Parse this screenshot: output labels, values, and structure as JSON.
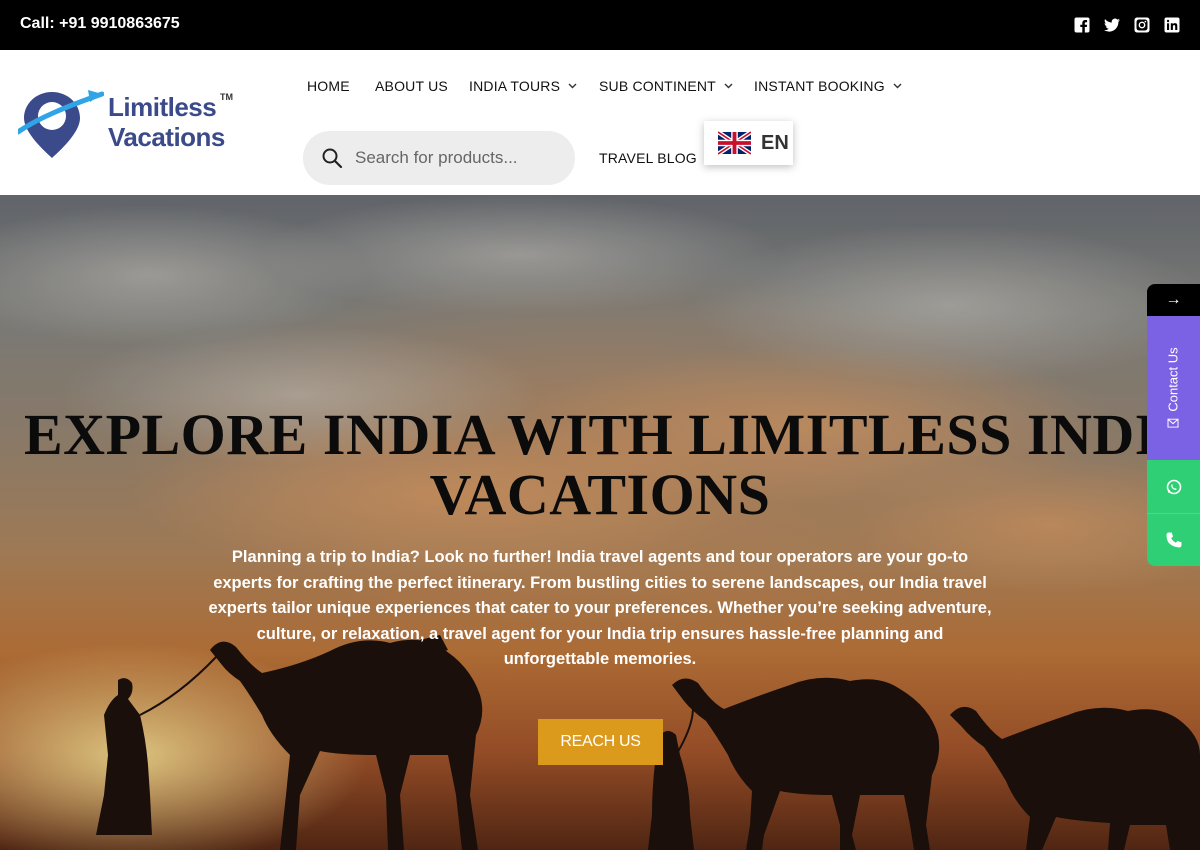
{
  "topbar": {
    "call_text": "Call: +91 9910863675",
    "social_icons": [
      "facebook-icon",
      "twitter-icon",
      "instagram-icon",
      "linkedin-icon"
    ]
  },
  "header": {
    "logo": {
      "line1": "Limitless",
      "line2": "Vacations",
      "tm": "TM"
    },
    "nav": [
      {
        "label": "HOME",
        "has_dropdown": false
      },
      {
        "label": "ABOUT US",
        "has_dropdown": false
      },
      {
        "label": "INDIA TOURS",
        "has_dropdown": true
      },
      {
        "label": "SUB CONTINENT",
        "has_dropdown": true
      },
      {
        "label": "INSTANT BOOKING",
        "has_dropdown": true
      },
      {
        "label": "TRAVEL BLOG",
        "has_dropdown": false
      }
    ],
    "search": {
      "placeholder": "Search for products..."
    },
    "language": {
      "code": "EN",
      "flag": "uk-flag-icon"
    }
  },
  "hero": {
    "title_line1": "EXPLORE INDIA WITH LIMITLESS INDIA",
    "title_line2": "VACATIONS",
    "paragraph": "Planning a trip to India? Look no further! India travel agents and tour operators are your go-to experts for crafting the perfect itinerary. From bustling cities to serene landscapes, our India travel experts tailor unique experiences that cater to your preferences. Whether you’re seeking adventure, culture, or relaxation, a travel agent for your India trip ensures hassle-free planning and unforgettable memories.",
    "cta_label": "REACH US"
  },
  "side_widget": {
    "arrow": "→",
    "contact_label": "Contact Us"
  },
  "colors": {
    "topbar_bg": "#000000",
    "cta_bg": "#dc9a1c",
    "contact_bg": "#7b61e4",
    "whatsapp_bg": "#2fcf75",
    "logo_blue": "#3b4a8a"
  }
}
